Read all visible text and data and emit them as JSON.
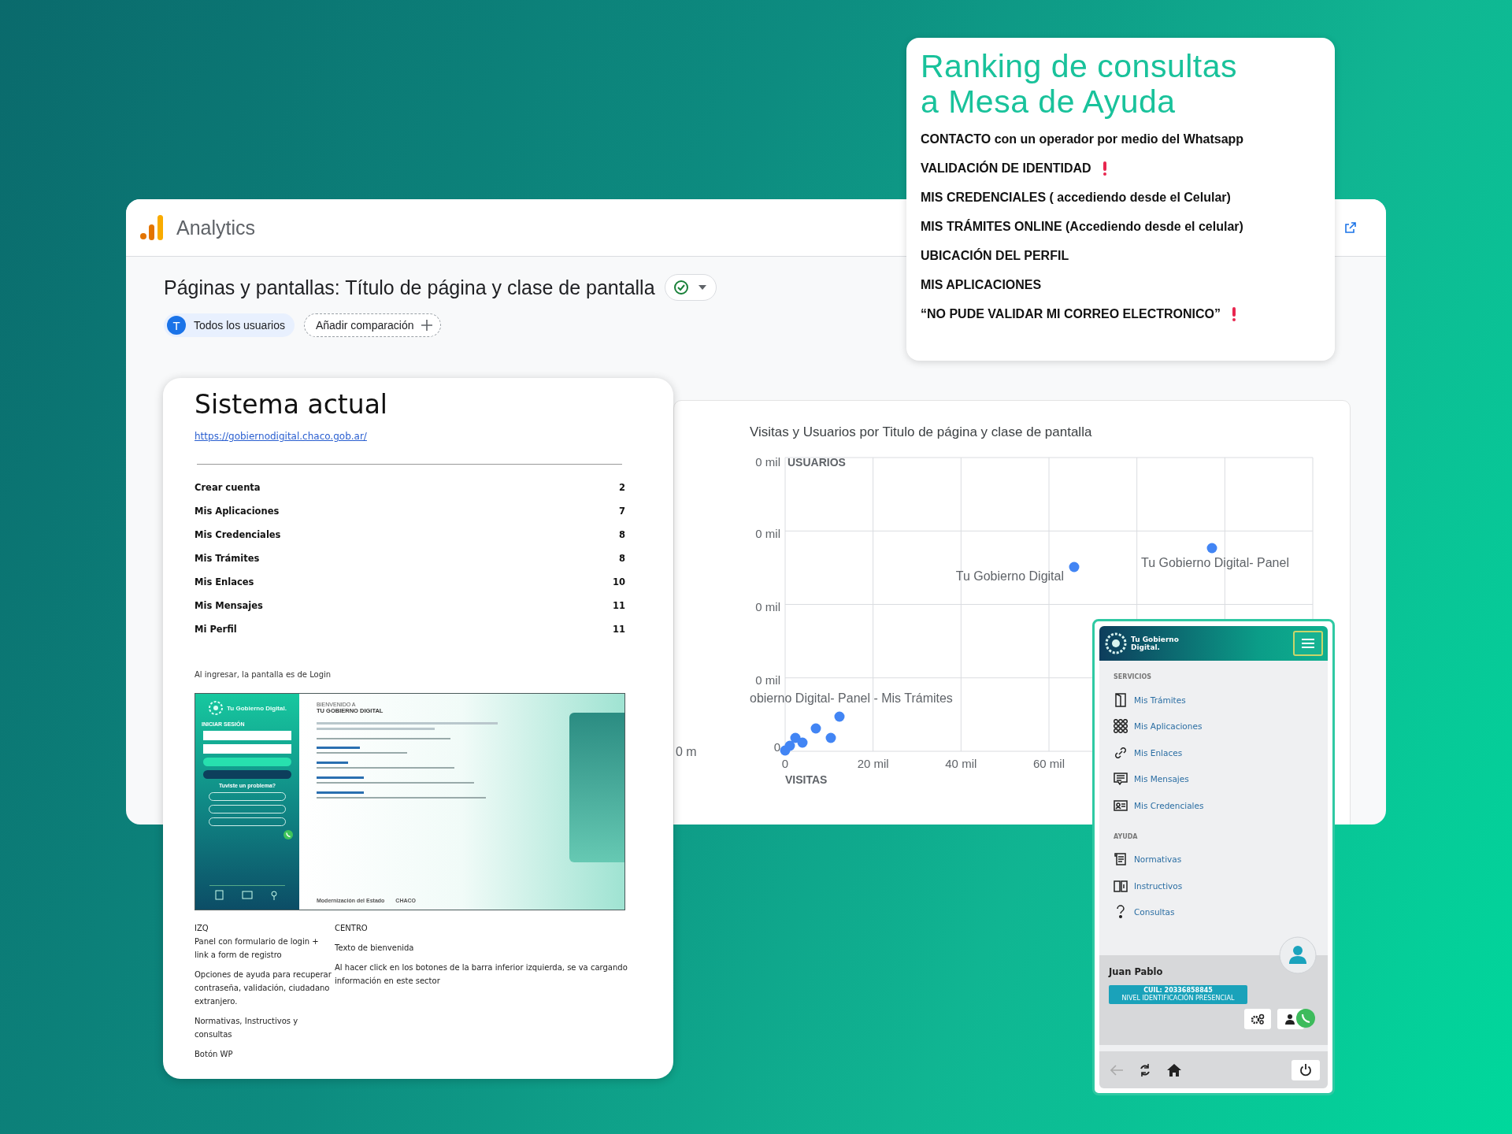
{
  "analytics": {
    "app_name": "Analytics",
    "page_title": "Páginas y pantallas: Título de página y clase de pantalla",
    "segments": [
      {
        "kind": "segment",
        "avatar": "T",
        "label": "Todos los usuarios"
      },
      {
        "kind": "add",
        "label": "Añadir comparación"
      }
    ],
    "chart": {
      "title": "Visitas y Usuarios por Titulo de página y clase de pantalla",
      "y_label": "USUARIOS",
      "x_label": "VISITAS",
      "y_ticks": [
        "0 mil",
        "0 mil",
        "0 mil",
        "0 mil",
        "0"
      ],
      "x_ticks": [
        "0",
        "20 mil",
        "40 mil",
        "60 mil"
      ],
      "point_labels": [
        "Tu Gobierno Digital",
        "Tu Gobierno Digital- Panel",
        "obierno Digital- Panel - Mis Trámites"
      ],
      "edge_text": "0 m"
    }
  },
  "ranking": {
    "title_lines": [
      "Ranking de consultas",
      "a Mesa de Ayuda"
    ],
    "items": [
      {
        "text": "CONTACTO con un operador por medio del Whatsapp",
        "alert": false
      },
      {
        "text": "VALIDACIÓN DE IDENTIDAD",
        "alert": true
      },
      {
        "text": "MIS CREDENCIALES ( accediendo desde el Celular)",
        "alert": false
      },
      {
        "text": "MIS TRÁMITES ONLINE (Accediendo desde el celular)",
        "alert": false
      },
      {
        "text": "UBICACIÓN DEL PERFIL",
        "alert": false
      },
      {
        "text": "MIS APLICACIONES",
        "alert": false
      },
      {
        "text": "“NO PUDE VALIDAR MI CORREO ELECTRONICO”",
        "alert": true
      }
    ]
  },
  "sistema": {
    "title": "Sistema actual",
    "link": "https://gobiernodigital.chaco.gob.ar/",
    "rows": [
      {
        "label": "Crear cuenta",
        "value": "2"
      },
      {
        "label": "Mis Aplicaciones",
        "value": "7"
      },
      {
        "label": "Mis Credenciales",
        "value": "8"
      },
      {
        "label": "Mis Trámites",
        "value": "8"
      },
      {
        "label": "Mis Enlaces",
        "value": "10"
      },
      {
        "label": "Mis Mensajes",
        "value": "11"
      },
      {
        "label": "Mi Perfil",
        "value": "11"
      }
    ],
    "note": "Al ingresar, la pantalla es de Login",
    "preview": {
      "brand": "Tu Gobierno Digital.",
      "login_heading": "INICIAR SESIÓN",
      "help_heading": "Tuviste un problema?",
      "welcome_small": "BIENVENIDO A",
      "welcome_big": "TU GOBIERNO DIGITAL",
      "footer_logos": [
        "Modernización del Estado",
        "CHACO"
      ]
    },
    "columns": [
      {
        "heading": "IZQ",
        "paragraphs": [
          "Panel con formulario de login + link a form de registro",
          "Opciones de ayuda para recuperar contraseña, validación, ciudadano extranjero.",
          "Normativas, Instructivos y consultas",
          "Botón WP"
        ]
      },
      {
        "heading": "CENTRO",
        "paragraphs": [
          "Texto de bienvenida",
          "Al hacer click en los botones de la barra inferior izquierda, se va cargando información en este sector"
        ]
      }
    ]
  },
  "mobile": {
    "brand": "Tu Gobierno Digital.",
    "sections": [
      {
        "heading": "SERVICIOS",
        "items": [
          "Mis Trámites",
          "Mis Aplicaciones",
          "Mis Enlaces",
          "Mis Mensajes",
          "Mis Credenciales"
        ]
      },
      {
        "heading": "AYUDA",
        "items": [
          "Normativas",
          "Instructivos",
          "Consultas"
        ]
      }
    ],
    "user": {
      "name": "Juan Pablo",
      "cuil": "CUIL: 20336858845",
      "level": "NIVEL IDENTIFICACIÓN PRESENCIAL"
    }
  }
}
